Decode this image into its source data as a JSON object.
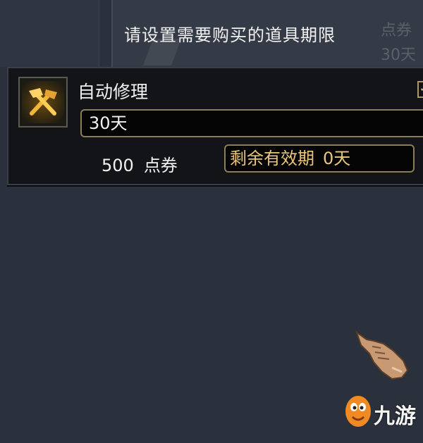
{
  "background": {
    "faded_price_label": "点券",
    "faded_price_value": "30天"
  },
  "dialog": {
    "title": "请设置需要购买的道具期限"
  },
  "item": {
    "name": "自动修理",
    "checkbox_checked": true,
    "duration": "30天",
    "price_amount": "500",
    "price_unit": "点券",
    "remaining_label": "剩余有效期",
    "remaining_value": "0天"
  },
  "watermark": {
    "text": "九游"
  },
  "colors": {
    "background": "#2b313c",
    "panel": "#121417",
    "field_border": "#8c7d56",
    "accent_text": "#e9c67a"
  },
  "icons": {
    "item": "hammer-pick-icon",
    "cursor": "gauntlet-hand-cursor-icon",
    "logo": "orange-mascot-logo"
  }
}
